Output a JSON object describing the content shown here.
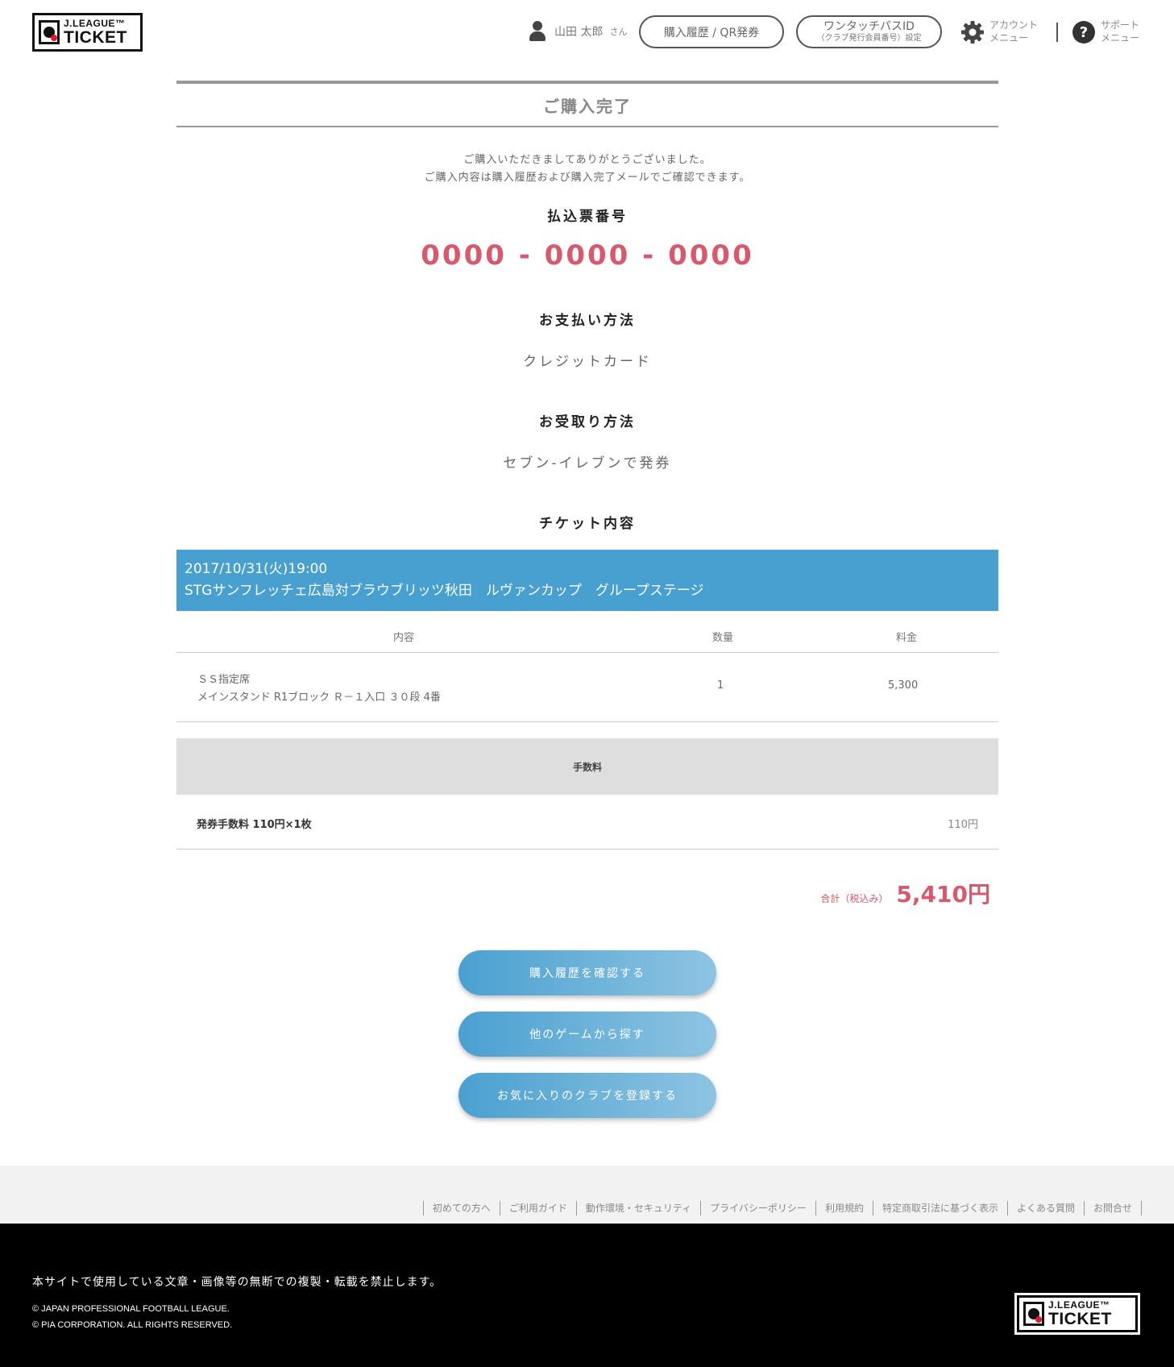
{
  "header": {
    "logo": {
      "line1": "J.LEAGUE™",
      "line2": "TICKET"
    },
    "user_name": "山田 太郎",
    "user_suffix": "さん",
    "history_button": "購入履歴 / QR発券",
    "pass_button": {
      "main": "ワンタッチパスID",
      "sub": "（クラブ発行会員番号）設定"
    },
    "account_menu": {
      "line1": "アカウント",
      "line2": "メニュー"
    },
    "support_menu": {
      "line1": "サポート",
      "line2": "メニュー"
    }
  },
  "page_title": "ご購入完了",
  "thanks": {
    "line1": "ご購入いただきましてありがとうございました。",
    "line2": "ご購入内容は購入履歴および購入完了メールでご確認できます。"
  },
  "payment_number": {
    "label": "払込票番号",
    "value": "0000 - 0000 - 0000"
  },
  "payment_method": {
    "label": "お支払い方法",
    "value": "クレジットカード"
  },
  "receipt_method": {
    "label": "お受取り方法",
    "value": "セブン-イレブンで発券"
  },
  "ticket": {
    "label": "チケット内容",
    "event_date": "2017/10/31(火)19:00",
    "event_name": "STGサンフレッチェ広島対ブラウブリッツ秋田　ルヴァンカップ　グループステージ",
    "columns": {
      "content": "内容",
      "quantity": "数量",
      "price": "料金"
    },
    "row": {
      "seat_type": "ＳＳ指定席",
      "seat_detail": "メインスタンド R1ブロック Ｒ－１入口 ３０段 4番",
      "quantity": "1",
      "price": "5,300"
    }
  },
  "fees": {
    "header": "手数料",
    "item_label": "発券手数料 110円×1枚",
    "item_value": "110円"
  },
  "total": {
    "label": "合計（税込み）",
    "amount": "5,410円"
  },
  "buttons": {
    "check_history": "購入履歴を確認する",
    "other_games": "他のゲームから探す",
    "favorite_club": "お気に入りのクラブを登録する"
  },
  "footer": {
    "links": [
      "初めての方へ",
      "ご利用ガイド",
      "動作環境・セキュリティ",
      "プライバシーポリシー",
      "利用規約",
      "特定商取引法に基づく表示",
      "よくある質問",
      "お問合せ"
    ],
    "notice": "本サイトで使用している文章・画像等の無断での複製・転載を禁止します。",
    "copyright1": "© JAPAN PROFESSIONAL FOOTBALL LEAGUE.",
    "copyright2": "© PIA CORPORATION. ALL RIGHTS RESERVED."
  },
  "colors": {
    "accent_blue": "#48a0d0",
    "price_red": "#d9586c",
    "footer_black": "#000000"
  }
}
